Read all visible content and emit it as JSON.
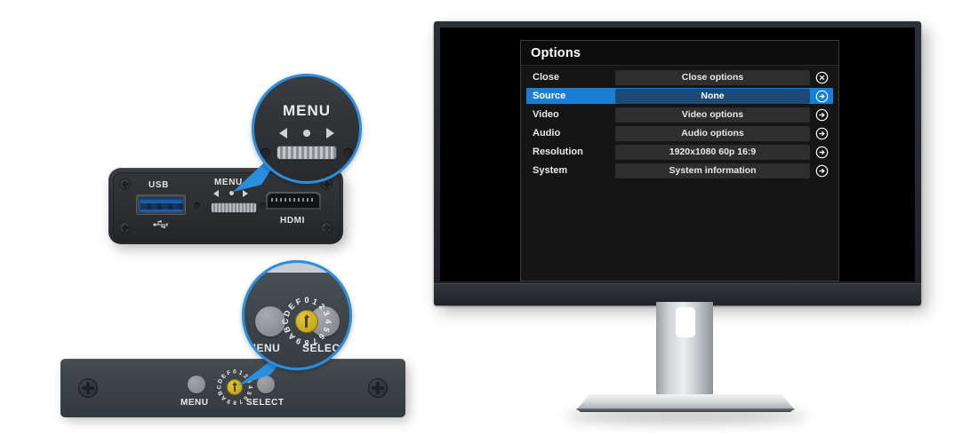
{
  "osd": {
    "title": "Options",
    "rows": [
      {
        "label": "Close",
        "value": "Close options",
        "icon": "close-circle-icon",
        "selected": false
      },
      {
        "label": "Source",
        "value": "None",
        "icon": "arrow-right-circle-icon",
        "selected": true
      },
      {
        "label": "Video",
        "value": "Video options",
        "icon": "arrow-right-circle-icon",
        "selected": false
      },
      {
        "label": "Audio",
        "value": "Audio options",
        "icon": "arrow-right-circle-icon",
        "selected": false
      },
      {
        "label": "Resolution",
        "value": "1920x1080 60p 16:9",
        "icon": "arrow-right-circle-icon",
        "selected": false
      },
      {
        "label": "System",
        "value": "System information",
        "icon": "arrow-right-circle-icon",
        "selected": false
      }
    ],
    "highlight_color": "#1a7fd4",
    "value_bg_color": "#2e2e2e",
    "selected_value_bg_color": "#1d4a74",
    "panel_bg_color": "#151515"
  },
  "device_top": {
    "usb_label": "USB",
    "menu_label": "MENU",
    "hdmi_label": "HDMI",
    "usb_port_color": "#1f5fa8"
  },
  "device_bottom": {
    "menu_label": "MENU",
    "select_label": "SELECT",
    "dial_digits": [
      "0",
      "1",
      "2",
      "3",
      "4",
      "5",
      "6",
      "7",
      "8",
      "9",
      "A",
      "B",
      "C",
      "D",
      "E",
      "F"
    ],
    "dial_color": "#d4b82a"
  },
  "magnifier_top": {
    "menu_label": "MENU",
    "ring_color": "#2b8fe0"
  },
  "magnifier_bottom": {
    "menu_label": "MENU",
    "select_label": "SELECT",
    "ring_color": "#2b8fe0"
  }
}
